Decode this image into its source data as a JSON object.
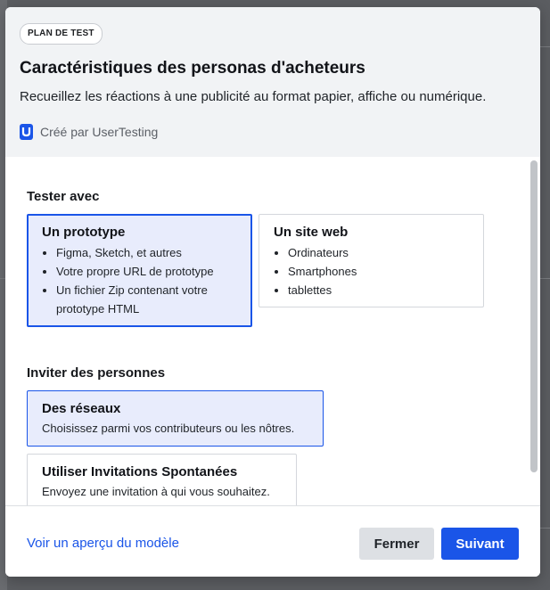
{
  "modal": {
    "badge": "PLAN DE TEST",
    "title": "Caractéristiques des personas d'acheteurs",
    "subtitle": "Recueillez les réactions à une publicité au format papier, affiche ou numérique.",
    "creator": "Créé par UserTesting"
  },
  "test_with": {
    "label": "Tester avec",
    "options": [
      {
        "title": "Un prototype",
        "selected": true,
        "bullets": [
          "Figma, Sketch, et autres",
          "Votre propre URL de prototype",
          "Un fichier Zip contenant votre prototype HTML"
        ]
      },
      {
        "title": "Un site web",
        "selected": false,
        "bullets": [
          "Ordinateurs",
          "Smartphones",
          "tablettes"
        ]
      }
    ]
  },
  "invite": {
    "label": "Inviter des personnes",
    "options": [
      {
        "title": "Des réseaux",
        "description": "Choisissez parmi vos contributeurs ou les nôtres.",
        "selected": true
      },
      {
        "title": "Utiliser Invitations Spontanées",
        "description": "Envoyez une invitation à qui vous souhaitez.",
        "selected": false
      }
    ]
  },
  "footer": {
    "preview_link": "Voir un aperçu du modèle",
    "close_button": "Fermer",
    "next_button": "Suivant"
  },
  "colors": {
    "accent": "#1a55e8",
    "selected_bg": "#e8ecfc",
    "header_bg": "#f1f3f5"
  },
  "icons": {
    "creator_logo": "usertesting-logo-icon"
  }
}
